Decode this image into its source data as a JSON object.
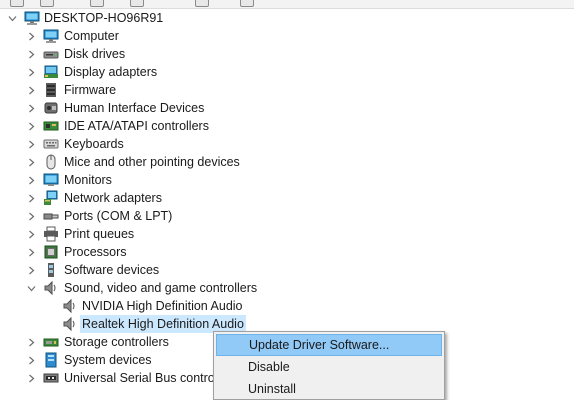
{
  "window": {
    "toolbar_icons": [
      "back-icon",
      "forward-icon",
      "properties-icon",
      "help-icon",
      "scan-icon",
      "update-icon"
    ]
  },
  "tree": {
    "root": {
      "label": "DESKTOP-HO96R91",
      "icon": "computer-icon",
      "expanded": true
    },
    "categories": [
      {
        "label": "Computer",
        "icon": "computer-icon"
      },
      {
        "label": "Disk drives",
        "icon": "disk-drive-icon"
      },
      {
        "label": "Display adapters",
        "icon": "display-adapter-icon"
      },
      {
        "label": "Firmware",
        "icon": "firmware-icon"
      },
      {
        "label": "Human Interface Devices",
        "icon": "hid-icon"
      },
      {
        "label": "IDE ATA/ATAPI controllers",
        "icon": "ide-controller-icon"
      },
      {
        "label": "Keyboards",
        "icon": "keyboard-icon"
      },
      {
        "label": "Mice and other pointing devices",
        "icon": "mouse-icon"
      },
      {
        "label": "Monitors",
        "icon": "monitor-icon"
      },
      {
        "label": "Network adapters",
        "icon": "network-adapter-icon"
      },
      {
        "label": "Ports (COM & LPT)",
        "icon": "port-icon"
      },
      {
        "label": "Print queues",
        "icon": "printer-icon"
      },
      {
        "label": "Processors",
        "icon": "processor-icon"
      },
      {
        "label": "Software devices",
        "icon": "software-device-icon"
      },
      {
        "label": "Sound, video and game controllers",
        "icon": "speaker-icon",
        "expanded": true,
        "children": [
          {
            "label": "NVIDIA High Definition Audio",
            "icon": "speaker-icon",
            "selected": false
          },
          {
            "label": "Realtek High Definition Audio",
            "icon": "speaker-icon",
            "selected": true
          }
        ]
      },
      {
        "label": "Storage controllers",
        "icon": "storage-controller-icon"
      },
      {
        "label": "System devices",
        "icon": "system-device-icon"
      },
      {
        "label": "Universal Serial Bus controllers",
        "icon": "usb-icon"
      }
    ]
  },
  "context_menu": {
    "items": [
      {
        "label": "Update Driver Software...",
        "mnemonic": "P",
        "highlighted": true
      },
      {
        "label": "Disable",
        "mnemonic": "D",
        "highlighted": false
      },
      {
        "label": "Uninstall",
        "mnemonic": "U",
        "highlighted": false
      }
    ]
  },
  "colors": {
    "selection": "#cce8ff",
    "menu_highlight": "#91c9f7",
    "menu_background": "#f0f0f0",
    "chevron": "#6d6d6d"
  }
}
